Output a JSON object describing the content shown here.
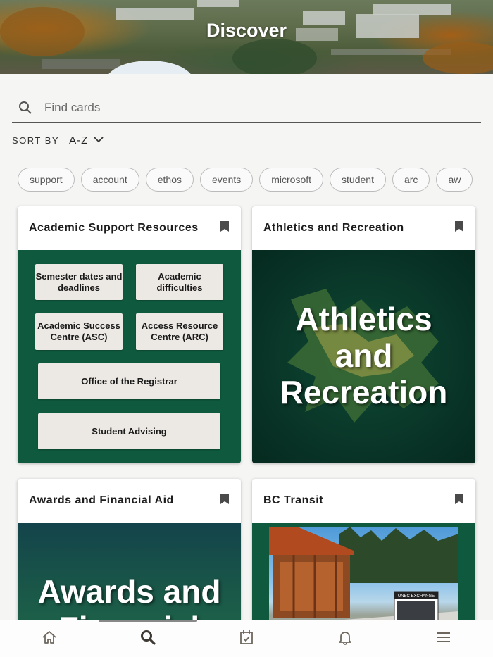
{
  "header": {
    "title": "Discover"
  },
  "search": {
    "placeholder": "Find cards"
  },
  "sort": {
    "label": "SORT BY",
    "value": "A-Z"
  },
  "chips": [
    "support",
    "account",
    "ethos",
    "events",
    "microsoft",
    "student",
    "arc",
    "aw"
  ],
  "cards": [
    {
      "title": "Academic Support Resources",
      "tiles": [
        "Semester dates and deadlines",
        "Academic difficulties",
        "Academic Success Centre (ASC)",
        "Access Resource Centre (ARC)",
        "Office of the Registrar",
        "Student Advising"
      ]
    },
    {
      "title": "Athletics and Recreation",
      "banner_lines": [
        "Athletics",
        "and",
        "Recreation"
      ]
    },
    {
      "title": "Awards and Financial Aid",
      "banner_lines": [
        "Awards and",
        "Financial"
      ]
    },
    {
      "title": "BC Transit",
      "photo_sign": "UNBC EXCHANGE"
    }
  ],
  "nav": {
    "items": [
      "home-icon",
      "search-icon",
      "calendar-check-icon",
      "bell-icon",
      "menu-icon"
    ],
    "active": "search-icon"
  },
  "colors": {
    "brand_green": "#0f5a3f",
    "dark_green": "#083226",
    "accent_gold": "#c9a227",
    "active_icon": "#3e3a33",
    "inactive_icon": "#6d675e"
  }
}
